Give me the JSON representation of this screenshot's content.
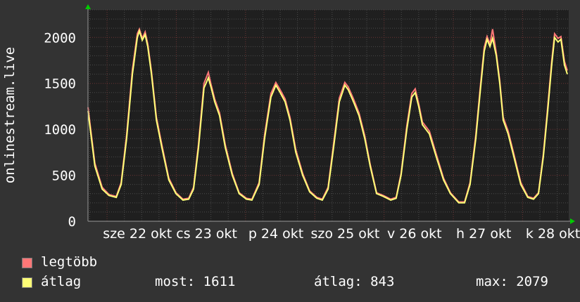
{
  "chart_data": {
    "type": "line",
    "ylabel": "onlinestream.live",
    "ylim": [
      0,
      2300
    ],
    "yticks": [
      0,
      500,
      1000,
      1500,
      2000
    ],
    "x_unit": "hours since start",
    "xlim": [
      0,
      166.6
    ],
    "first_midnight_hour": 6.6,
    "xtick_labels": [
      "sze 22 okt",
      "cs 23 okt",
      "p 24 okt",
      "szo 25 okt",
      "v 26 okt",
      "h 27 okt",
      "k 28 okt"
    ],
    "grid": true,
    "colors": {
      "max": "#ff7777",
      "avg": "#ffff77",
      "plot_bg": "#1f1f1f",
      "major_grid": "#6a3434",
      "minor_grid": "#4a4a4a",
      "arrow": "#00cc00"
    },
    "x": [
      0,
      2.4,
      4.9,
      7.3,
      9.8,
      11.5,
      13.4,
      15.4,
      17.1,
      17.8,
      18.8,
      19.8,
      20.7,
      22,
      23.7,
      25.6,
      28,
      30.5,
      32.9,
      34.9,
      36.6,
      38.3,
      40.2,
      41.7,
      42.7,
      43.9,
      45.6,
      47.6,
      50,
      52.4,
      54.9,
      56.8,
      59.3,
      61.2,
      63.4,
      65.1,
      66.6,
      68.3,
      70,
      72,
      74.4,
      76.8,
      79.3,
      81.2,
      83.2,
      85.1,
      87.1,
      89,
      90.2,
      92,
      93.9,
      95.9,
      97.8,
      100,
      102.4,
      104.9,
      106.8,
      108.5,
      110.5,
      112.2,
      113.4,
      114.6,
      115.9,
      118.3,
      120.7,
      123.2,
      125.6,
      128.5,
      130.5,
      132.4,
      134.4,
      135.9,
      137.3,
      138.3,
      139.3,
      140.2,
      141.5,
      142.7,
      143.9,
      145.6,
      147.6,
      150,
      152.4,
      154.4,
      156.1,
      157.8,
      159.3,
      160.7,
      161.7,
      162.9,
      163.9,
      165.1,
      166.1
    ],
    "series": [
      {
        "name": "legtöbb",
        "values": [
          1240,
          630,
          370,
          290,
          270,
          420,
          940,
          1650,
          2040,
          2090,
          1990,
          2060,
          1930,
          1630,
          1130,
          830,
          470,
          310,
          240,
          250,
          370,
          840,
          1500,
          1620,
          1480,
          1330,
          1180,
          830,
          520,
          310,
          250,
          240,
          420,
          940,
          1390,
          1510,
          1430,
          1330,
          1130,
          780,
          520,
          330,
          260,
          240,
          370,
          840,
          1340,
          1510,
          1460,
          1330,
          1180,
          930,
          620,
          310,
          280,
          240,
          260,
          520,
          1040,
          1390,
          1440,
          1280,
          1080,
          980,
          730,
          470,
          310,
          210,
          210,
          420,
          940,
          1440,
          1890,
          2010,
          1930,
          2090,
          1830,
          1530,
          1130,
          980,
          730,
          420,
          270,
          250,
          310,
          730,
          1240,
          1740,
          2040,
          1990,
          2010,
          1740,
          1640
        ]
      },
      {
        "name": "átlag",
        "values": [
          1200,
          600,
          350,
          280,
          260,
          400,
          900,
          1600,
          2000,
          2070,
          1970,
          2030,
          1900,
          1600,
          1100,
          800,
          450,
          300,
          230,
          240,
          350,
          800,
          1450,
          1560,
          1450,
          1300,
          1150,
          800,
          500,
          300,
          240,
          230,
          400,
          900,
          1350,
          1480,
          1400,
          1300,
          1100,
          750,
          500,
          320,
          250,
          230,
          350,
          800,
          1300,
          1480,
          1430,
          1300,
          1150,
          900,
          600,
          300,
          270,
          230,
          250,
          500,
          1000,
          1350,
          1400,
          1250,
          1050,
          950,
          700,
          450,
          300,
          200,
          200,
          400,
          900,
          1400,
          1850,
          1980,
          1900,
          1990,
          1800,
          1500,
          1100,
          950,
          700,
          400,
          260,
          240,
          300,
          700,
          1200,
          1700,
          2000,
          1950,
          1980,
          1700,
          1600
        ]
      }
    ]
  },
  "legend": {
    "max_label": "legtöbb",
    "avg_label": "átlag",
    "most": "most: 1611",
    "atlag": "átlag: 843",
    "max": "max: 2079"
  }
}
